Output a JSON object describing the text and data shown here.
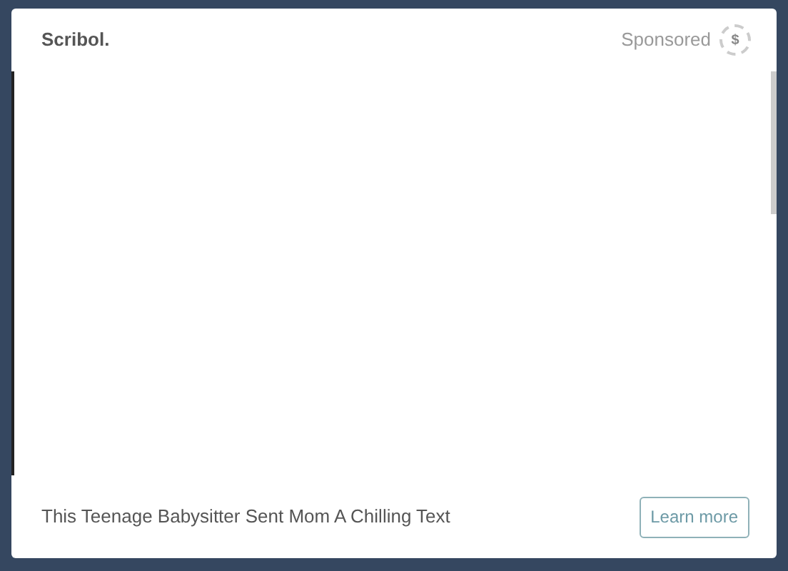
{
  "brand": "Scribol.",
  "sponsored": {
    "label": "Sponsored",
    "icon_glyph": "$"
  },
  "headline": "This Teenage Babysitter Sent Mom A Chilling Text",
  "button": "Learn more"
}
